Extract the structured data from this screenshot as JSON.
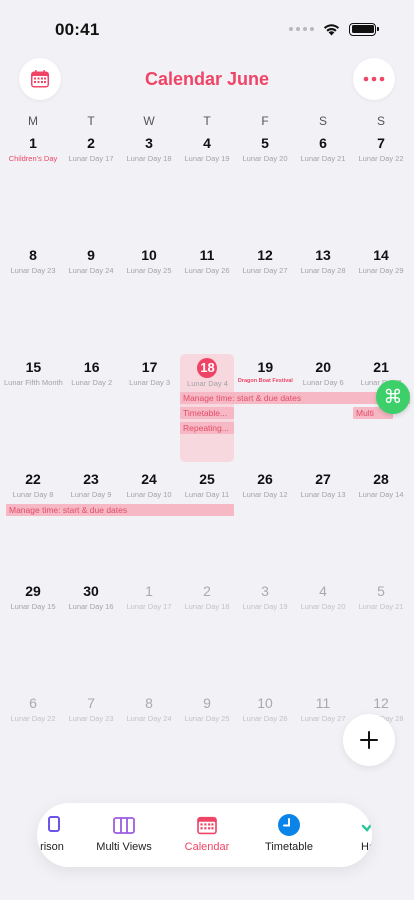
{
  "status": {
    "time": "00:41"
  },
  "header": {
    "title": "Calendar June"
  },
  "weekdays": [
    "M",
    "T",
    "W",
    "T",
    "F",
    "S",
    "S"
  ],
  "weeks": [
    [
      {
        "num": "1",
        "lunar": "Children's Day"
      },
      {
        "num": "2",
        "lunar": "Lunar Day 17"
      },
      {
        "num": "3",
        "lunar": "Lunar Day 18"
      },
      {
        "num": "4",
        "lunar": "Lunar Day 19"
      },
      {
        "num": "5",
        "lunar": "Lunar Day 20"
      },
      {
        "num": "6",
        "lunar": "Lunar Day 21"
      },
      {
        "num": "7",
        "lunar": "Lunar Day 22"
      }
    ],
    [
      {
        "num": "8",
        "lunar": "Lunar Day 23"
      },
      {
        "num": "9",
        "lunar": "Lunar Day 24"
      },
      {
        "num": "10",
        "lunar": "Lunar Day 25"
      },
      {
        "num": "11",
        "lunar": "Lunar Day 26"
      },
      {
        "num": "12",
        "lunar": "Lunar Day 27"
      },
      {
        "num": "13",
        "lunar": "Lunar Day 28"
      },
      {
        "num": "14",
        "lunar": "Lunar Day 29"
      }
    ],
    [
      {
        "num": "15",
        "lunar": "Lunar Fifth Month"
      },
      {
        "num": "16",
        "lunar": "Lunar Day 2"
      },
      {
        "num": "17",
        "lunar": "Lunar Day 3"
      },
      {
        "num": "18",
        "lunar": "Lunar Day 4"
      },
      {
        "num": "19",
        "lunar": "Dragon Boat Festival"
      },
      {
        "num": "20",
        "lunar": "Lunar Day 6"
      },
      {
        "num": "21",
        "lunar": "Lunar Day 7"
      }
    ],
    [
      {
        "num": "22",
        "lunar": "Lunar Day 8"
      },
      {
        "num": "23",
        "lunar": "Lunar Day 9"
      },
      {
        "num": "24",
        "lunar": "Lunar Day 10"
      },
      {
        "num": "25",
        "lunar": "Lunar Day 11"
      },
      {
        "num": "26",
        "lunar": "Lunar Day 12"
      },
      {
        "num": "27",
        "lunar": "Lunar Day 13"
      },
      {
        "num": "28",
        "lunar": "Lunar Day 14"
      }
    ],
    [
      {
        "num": "29",
        "lunar": "Lunar Day 15"
      },
      {
        "num": "30",
        "lunar": "Lunar Day 16"
      },
      {
        "num": "1",
        "lunar": "Lunar Day 17"
      },
      {
        "num": "2",
        "lunar": "Lunar Day 18"
      },
      {
        "num": "3",
        "lunar": "Lunar Day 19"
      },
      {
        "num": "4",
        "lunar": "Lunar Day 20"
      },
      {
        "num": "5",
        "lunar": "Lunar Day 21"
      }
    ],
    [
      {
        "num": "6",
        "lunar": "Lunar Day 22"
      },
      {
        "num": "7",
        "lunar": "Lunar Day 23"
      },
      {
        "num": "8",
        "lunar": "Lunar Day 24"
      },
      {
        "num": "9",
        "lunar": "Lunar Day 25"
      },
      {
        "num": "10",
        "lunar": "Lunar Day 26"
      },
      {
        "num": "11",
        "lunar": "Lunar Day 27"
      },
      {
        "num": "12",
        "lunar": "Lunar Day 28"
      }
    ]
  ],
  "today": {
    "week": 2,
    "day": 3
  },
  "events": {
    "manage_time_1": "Manage time: start & due dates",
    "timetable": "Timetable...",
    "repeating": "Repeating...",
    "multi": "Multi",
    "manage_time_2": "Manage time: start & due dates"
  },
  "tabs": [
    {
      "label": "rison",
      "icon": "comparison-icon"
    },
    {
      "label": "Multi Views",
      "icon": "multi-views-icon"
    },
    {
      "label": "Calendar",
      "icon": "calendar-icon"
    },
    {
      "label": "Timetable",
      "icon": "clock-icon"
    },
    {
      "label": "Ha",
      "icon": "habit-icon"
    }
  ],
  "colors": {
    "accent": "#f04466",
    "event": "#f6b8c4",
    "today_bg": "#f8d8df",
    "fab_green": "#3ccf6a"
  }
}
